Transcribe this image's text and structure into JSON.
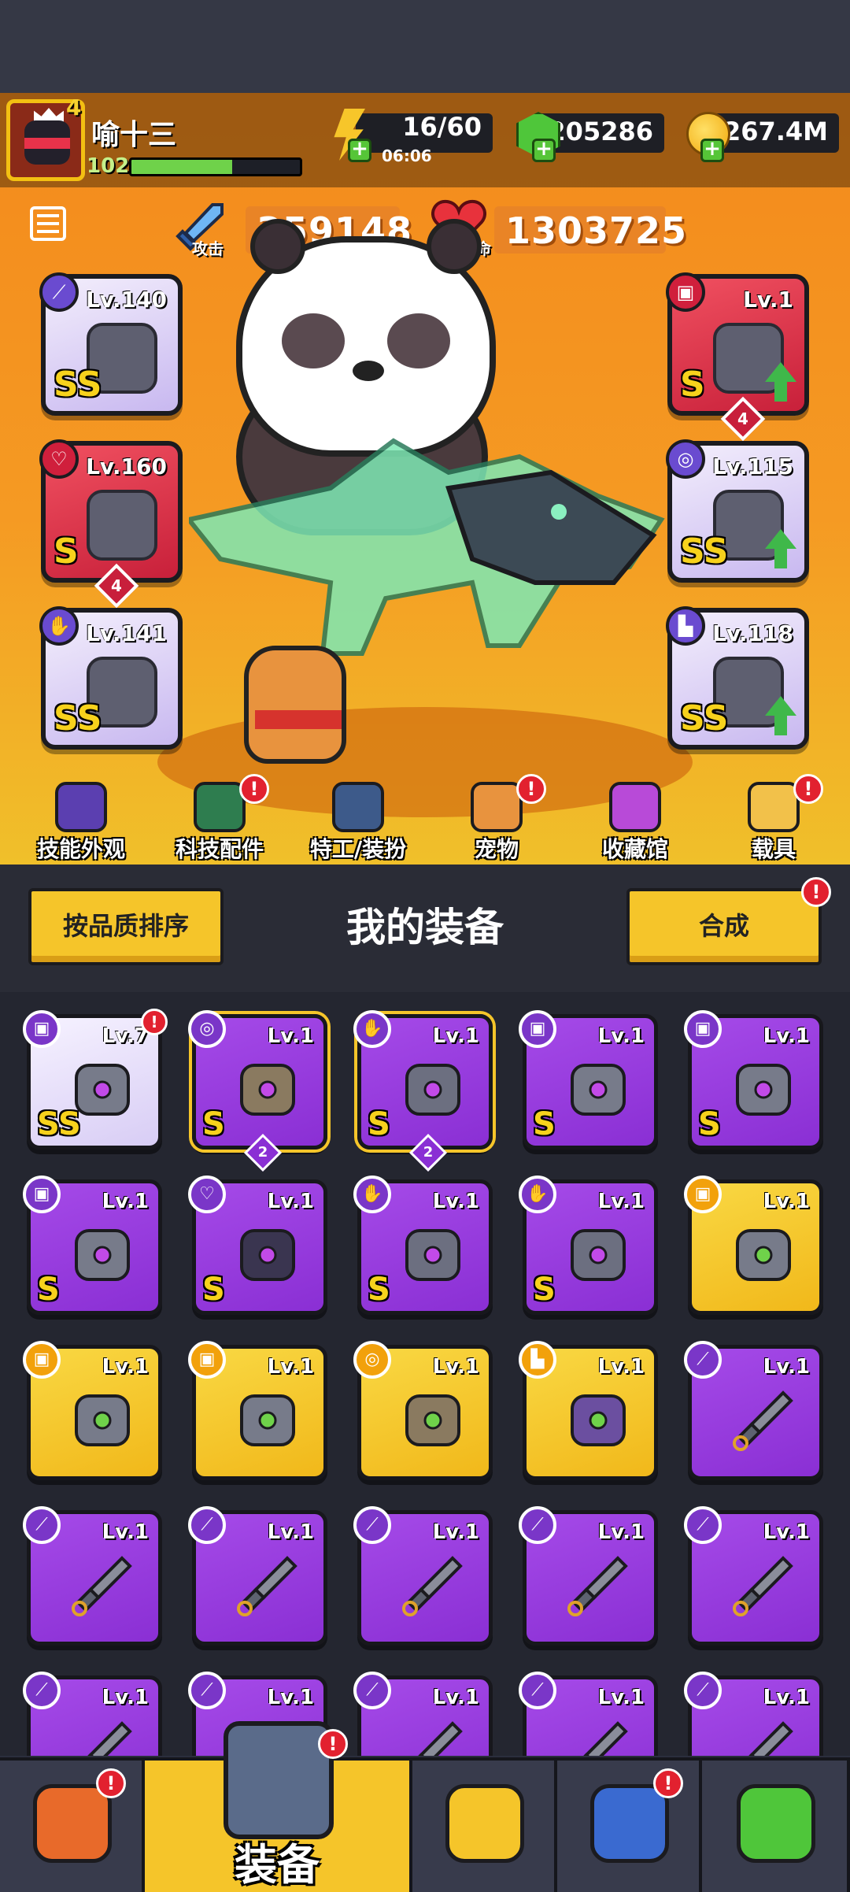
{
  "player": {
    "name": "喻十三",
    "level": "4",
    "xp": "102",
    "xp_progress": 0.6
  },
  "resources": {
    "energy": "16/60",
    "energy_timer": "06:06",
    "gems": "205286",
    "coins": "267.4M"
  },
  "stats": {
    "attack_label": "攻击",
    "attack_value": "359148",
    "hp_label": "生命",
    "hp_value": "1303725"
  },
  "equipped": {
    "left": [
      {
        "level": "Lv.140",
        "grade": "SS",
        "category": "weapon",
        "style": "purple-white"
      },
      {
        "level": "Lv.160",
        "grade": "S",
        "category": "necklace",
        "style": "red",
        "stars": "4"
      },
      {
        "level": "Lv.141",
        "grade": "SS",
        "category": "glove",
        "style": "purple-white"
      }
    ],
    "right": [
      {
        "level": "Lv.1",
        "grade": "S",
        "category": "armor",
        "style": "red",
        "stars": "4",
        "upgrade": true
      },
      {
        "level": "Lv.115",
        "grade": "SS",
        "category": "belt",
        "style": "purple-white",
        "upgrade": true
      },
      {
        "level": "Lv.118",
        "grade": "SS",
        "category": "boots",
        "style": "purple-white",
        "upgrade": true
      }
    ]
  },
  "nav": [
    {
      "label": "技能外观",
      "icon": "skill-hat-icon",
      "badge": false
    },
    {
      "label": "科技配件",
      "icon": "tech-hex-icon",
      "badge": true
    },
    {
      "label": "特工/装扮",
      "icon": "agent-mask-icon",
      "badge": false
    },
    {
      "label": "宠物",
      "icon": "pet-shiba-icon",
      "badge": true
    },
    {
      "label": "收藏馆",
      "icon": "collection-chest-icon",
      "badge": false
    },
    {
      "label": "载具",
      "icon": "vehicle-icon",
      "badge": true
    }
  ],
  "section": {
    "sort_button": "按品质排序",
    "title": "我的装备",
    "merge_button": "合成",
    "merge_badge": "!"
  },
  "inventory": [
    {
      "level": "Lv.7",
      "grade": "SS",
      "style": "white",
      "category": "armor",
      "badge": true
    },
    {
      "level": "Lv.1",
      "grade": "S",
      "style": "purple-sel",
      "category": "belt",
      "count": "2"
    },
    {
      "level": "Lv.1",
      "grade": "S",
      "style": "purple-sel",
      "category": "glove",
      "count": "2"
    },
    {
      "level": "Lv.1",
      "grade": "S",
      "style": "purple",
      "category": "armor"
    },
    {
      "level": "Lv.1",
      "grade": "S",
      "style": "purple",
      "category": "armor"
    },
    {
      "level": "Lv.1",
      "grade": "S",
      "style": "purple",
      "category": "armor"
    },
    {
      "level": "Lv.1",
      "grade": "S",
      "style": "purple",
      "category": "necklace"
    },
    {
      "level": "Lv.1",
      "grade": "S",
      "style": "purple",
      "category": "glove"
    },
    {
      "level": "Lv.1",
      "grade": "S",
      "style": "purple",
      "category": "glove"
    },
    {
      "level": "Lv.1",
      "grade": "",
      "style": "gold",
      "category": "armor"
    },
    {
      "level": "Lv.1",
      "grade": "",
      "style": "gold",
      "category": "armor"
    },
    {
      "level": "Lv.1",
      "grade": "",
      "style": "gold",
      "category": "armor"
    },
    {
      "level": "Lv.1",
      "grade": "",
      "style": "gold",
      "category": "belt"
    },
    {
      "level": "Lv.1",
      "grade": "",
      "style": "gold",
      "category": "boots"
    },
    {
      "level": "Lv.1",
      "grade": "",
      "style": "purple",
      "category": "weapon"
    },
    {
      "level": "Lv.1",
      "grade": "",
      "style": "purple",
      "category": "weapon"
    },
    {
      "level": "Lv.1",
      "grade": "",
      "style": "purple",
      "category": "weapon"
    },
    {
      "level": "Lv.1",
      "grade": "",
      "style": "purple",
      "category": "weapon"
    },
    {
      "level": "Lv.1",
      "grade": "",
      "style": "purple",
      "category": "weapon"
    },
    {
      "level": "Lv.1",
      "grade": "",
      "style": "purple",
      "category": "weapon"
    },
    {
      "level": "Lv.1",
      "grade": "",
      "style": "purple",
      "category": "weapon"
    },
    {
      "level": "Lv.1",
      "grade": "",
      "style": "purple",
      "category": "weapon"
    },
    {
      "level": "Lv.1",
      "grade": "",
      "style": "purple",
      "category": "weapon"
    },
    {
      "level": "Lv.1",
      "grade": "",
      "style": "purple",
      "category": "weapon"
    },
    {
      "level": "Lv.1",
      "grade": "",
      "style": "purple",
      "category": "weapon"
    }
  ],
  "bottom_tabs": [
    {
      "label": "",
      "icon": "shop-icon",
      "badge": true
    },
    {
      "label": "装备",
      "icon": "equipment-icon",
      "active": true,
      "badge": true
    },
    {
      "label": "",
      "icon": "battle-star-icon"
    },
    {
      "label": "",
      "icon": "planet-icon",
      "badge": true
    },
    {
      "label": "",
      "icon": "dna-icon"
    }
  ],
  "colors": {
    "purple": "#8a2fd4",
    "gold": "#f5c52a",
    "red": "#d01f3c",
    "green": "#56c538"
  }
}
